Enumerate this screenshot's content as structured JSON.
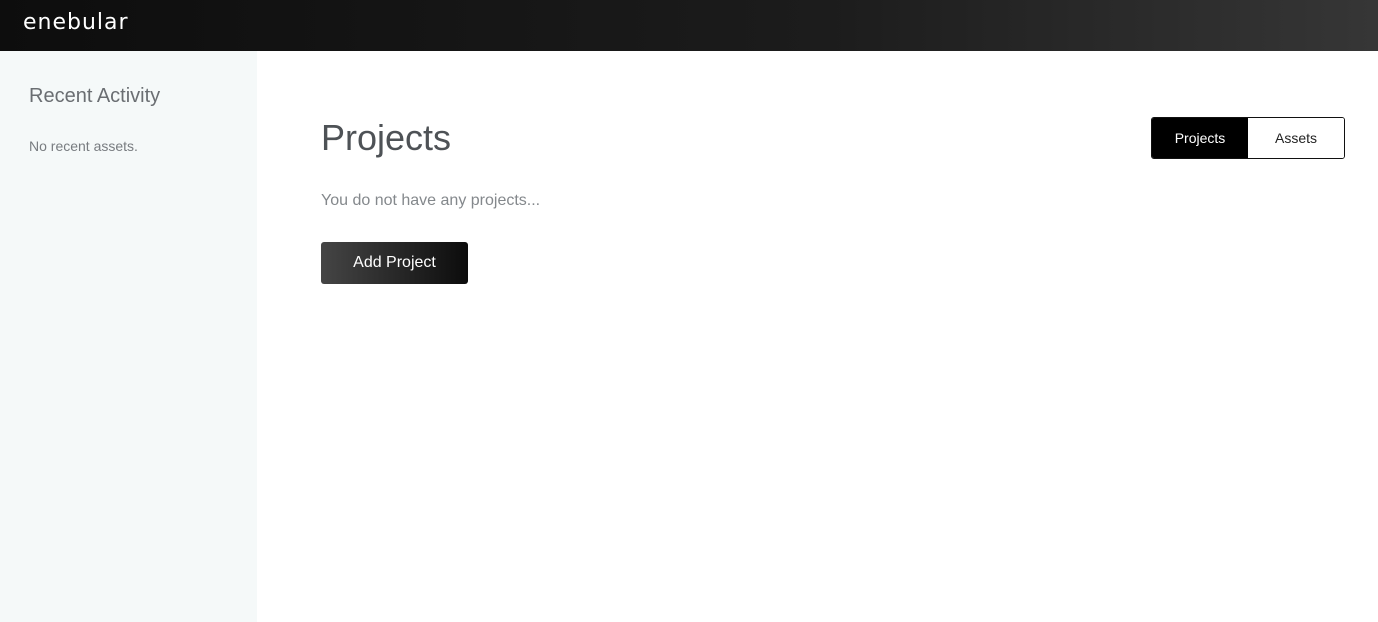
{
  "header": {
    "logo_text": "enebular"
  },
  "sidebar": {
    "title": "Recent Activity",
    "empty_message": "No recent assets."
  },
  "main": {
    "title": "Projects",
    "empty_message": "You do not have any projects...",
    "add_button_label": "Add Project",
    "toggle": {
      "options": [
        {
          "label": "Projects",
          "active": true
        },
        {
          "label": "Assets",
          "active": false
        }
      ]
    }
  },
  "colors": {
    "header_bg": "#1c1c1c",
    "sidebar_bg": "#f5f9f9",
    "active_toggle_bg": "#000000",
    "button_bg": "#262626"
  }
}
